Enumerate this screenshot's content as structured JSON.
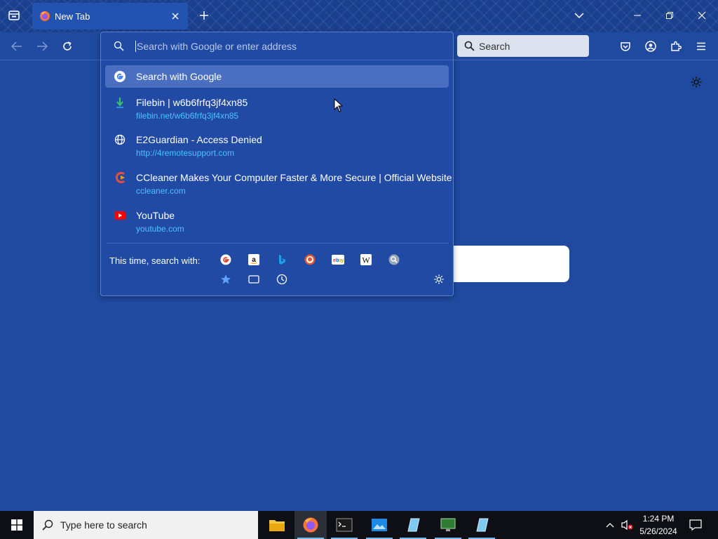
{
  "tab": {
    "title": "New Tab"
  },
  "toolbar": {
    "search_placeholder": "Search"
  },
  "urlbar": {
    "placeholder": "Search with Google or enter address"
  },
  "suggestions": [
    {
      "title": "Search with Google",
      "url": "",
      "icon": "google-icon"
    },
    {
      "title": "Filebin | w6b6frfq3jf4xn85",
      "url": "filebin.net/w6b6frfq3jf4xn85",
      "icon": "filebin-icon"
    },
    {
      "title": "E2Guardian - Access Denied",
      "url": "http://4remotesupport.com",
      "icon": "globe-icon"
    },
    {
      "title": "CCleaner Makes Your Computer Faster & More Secure | Official Website",
      "url": "ccleaner.com",
      "icon": "ccleaner-icon"
    },
    {
      "title": "YouTube",
      "url": "youtube.com",
      "icon": "youtube-icon"
    }
  ],
  "oneoff": {
    "label": "This time, search with:",
    "engines": [
      "google-icon",
      "amazon-icon",
      "bing-icon",
      "duckduckgo-icon",
      "ebay-icon",
      "wikipedia-icon",
      "search-engine-icon"
    ],
    "modes": [
      "bookmarks-icon",
      "tabs-icon",
      "history-icon"
    ]
  },
  "taskbar": {
    "search_placeholder": "Type here to search",
    "time": "1:24 PM",
    "date": "5/26/2024"
  },
  "colors": {
    "accent": "#1f4aa0",
    "link": "#4cc3ff",
    "selected": "#4a6fc0"
  }
}
